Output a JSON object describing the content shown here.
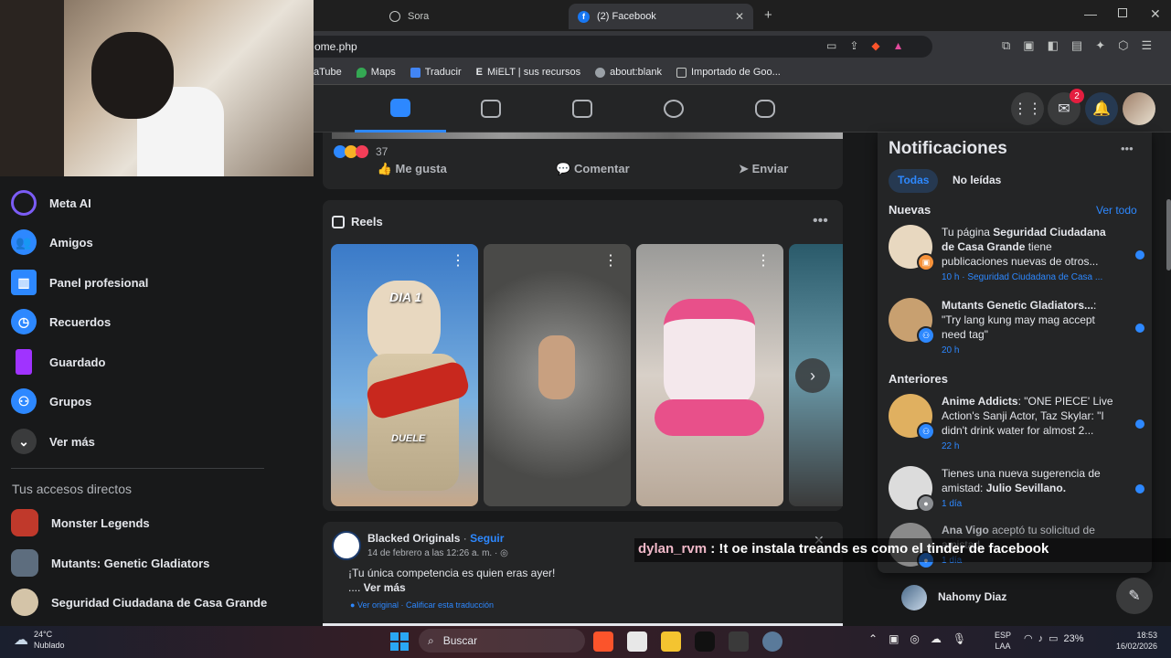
{
  "browser": {
    "tabs": [
      {
        "label": "Sora"
      },
      {
        "label": "(2) Facebook"
      }
    ],
    "url": "ome.php",
    "bookmarks": [
      "aTube",
      "Maps",
      "Traducir",
      "MiELT | sus recursos",
      "about:blank",
      "Importado de Goo..."
    ]
  },
  "header": {
    "messenger_badge": "2"
  },
  "sidebar": {
    "items": [
      {
        "label": "Meta AI",
        "icon": "meta-ai-icon",
        "color": "#7b5cf5"
      },
      {
        "label": "Amigos",
        "icon": "friends-icon",
        "color": "#2d88ff"
      },
      {
        "label": "Panel profesional",
        "icon": "dashboard-icon",
        "color": "#2d88ff"
      },
      {
        "label": "Recuerdos",
        "icon": "clock-icon",
        "color": "#2d88ff"
      },
      {
        "label": "Guardado",
        "icon": "bookmark-icon",
        "color": "#a033ff"
      },
      {
        "label": "Grupos",
        "icon": "groups-icon",
        "color": "#2d88ff"
      },
      {
        "label": "Ver más",
        "icon": "chevron-down-icon",
        "color": "#3a3b3c"
      }
    ],
    "shortcuts_title": "Tus accesos directos",
    "shortcuts": [
      {
        "label": "Monster Legends",
        "color": "#c0392b"
      },
      {
        "label": "Mutants: Genetic Gladiators",
        "color": "#5d6d7e"
      },
      {
        "label": "Seguridad Ciudadana de Casa Grande",
        "color": "#d4c4a8"
      }
    ]
  },
  "feed": {
    "reaction_count": "37",
    "actions": [
      "Me gusta",
      "Comentar",
      "Enviar"
    ],
    "reels_title": "Reels",
    "reels": [
      {
        "caption_top": "DIA 1",
        "caption_bottom": "DUELE",
        "color": "#3a7ac8"
      },
      {
        "caption_top": "",
        "caption_bottom": "",
        "color": "#6a6a68"
      },
      {
        "caption_top": "",
        "caption_bottom": "",
        "color": "#c8b8a8"
      },
      {
        "caption_top": "",
        "caption_bottom": "",
        "color": "#2a5a6a"
      }
    ],
    "post": {
      "author": "Blacked Originals",
      "follow": "Seguir",
      "date": "14 de febrero a las 12:26 a. m. ·",
      "text": "¡Tu única competencia es quien eras ayer!",
      "more_prefix": ".... ",
      "more": "Ver más",
      "original": "Ver original",
      "translate": "Calificar esta traducción"
    }
  },
  "notifications": {
    "title": "Notificaciones",
    "filters": [
      "Todas",
      "No leídas"
    ],
    "new_title": "Nuevas",
    "see_all": "Ver todo",
    "earlier_title": "Anteriores",
    "items": [
      {
        "pre": "Tu página ",
        "bold": "Seguridad Ciudadana de Casa Grande",
        "post": " tiene publicaciones nuevas de otros...",
        "time": "10 h · Seguridad Ciudadana de Casa ...",
        "color": "#e8d8c0",
        "badge_color": "#f7923a"
      },
      {
        "pre": "",
        "bold": "Mutants Genetic Gladiators...",
        "post": ": \"Try lang kung may mag accept need tag\"",
        "time": "20 h",
        "color": "#c8a070",
        "badge_color": "#2d88ff"
      },
      {
        "pre": "",
        "bold": "Anime Addicts",
        "post": ": \"ONE PIECE' Live Action's Sanji Actor, Taz Skylar: \"I didn't drink water for almost 2...",
        "time": "22 h",
        "color": "#e0b060",
        "badge_color": "#2d88ff"
      },
      {
        "pre": "Tienes una nueva sugerencia de amistad: ",
        "bold": "Julio Sevillano.",
        "post": "",
        "time": "1 día",
        "color": "#dcdcdc",
        "badge_color": "#8a8d91"
      },
      {
        "pre": "",
        "bold": "Ana Vigo",
        "post": " aceptó tu solicitud de amistad.",
        "time": "1 día",
        "color": "#8a8a8a",
        "badge_color": "#2d88ff"
      }
    ]
  },
  "contact": {
    "name": "Nahomy Diaz"
  },
  "chat_overlay": {
    "user": "dylan_rvm",
    "message": " : !t oe instala treands es como el tinder de facebook"
  },
  "taskbar": {
    "weather_temp": "24°C",
    "weather_desc": "Nublado",
    "search": "Buscar",
    "lang1": "ESP",
    "lang2": "LAA",
    "battery": "23%",
    "time": "18:53",
    "date": "16/02/2026"
  }
}
